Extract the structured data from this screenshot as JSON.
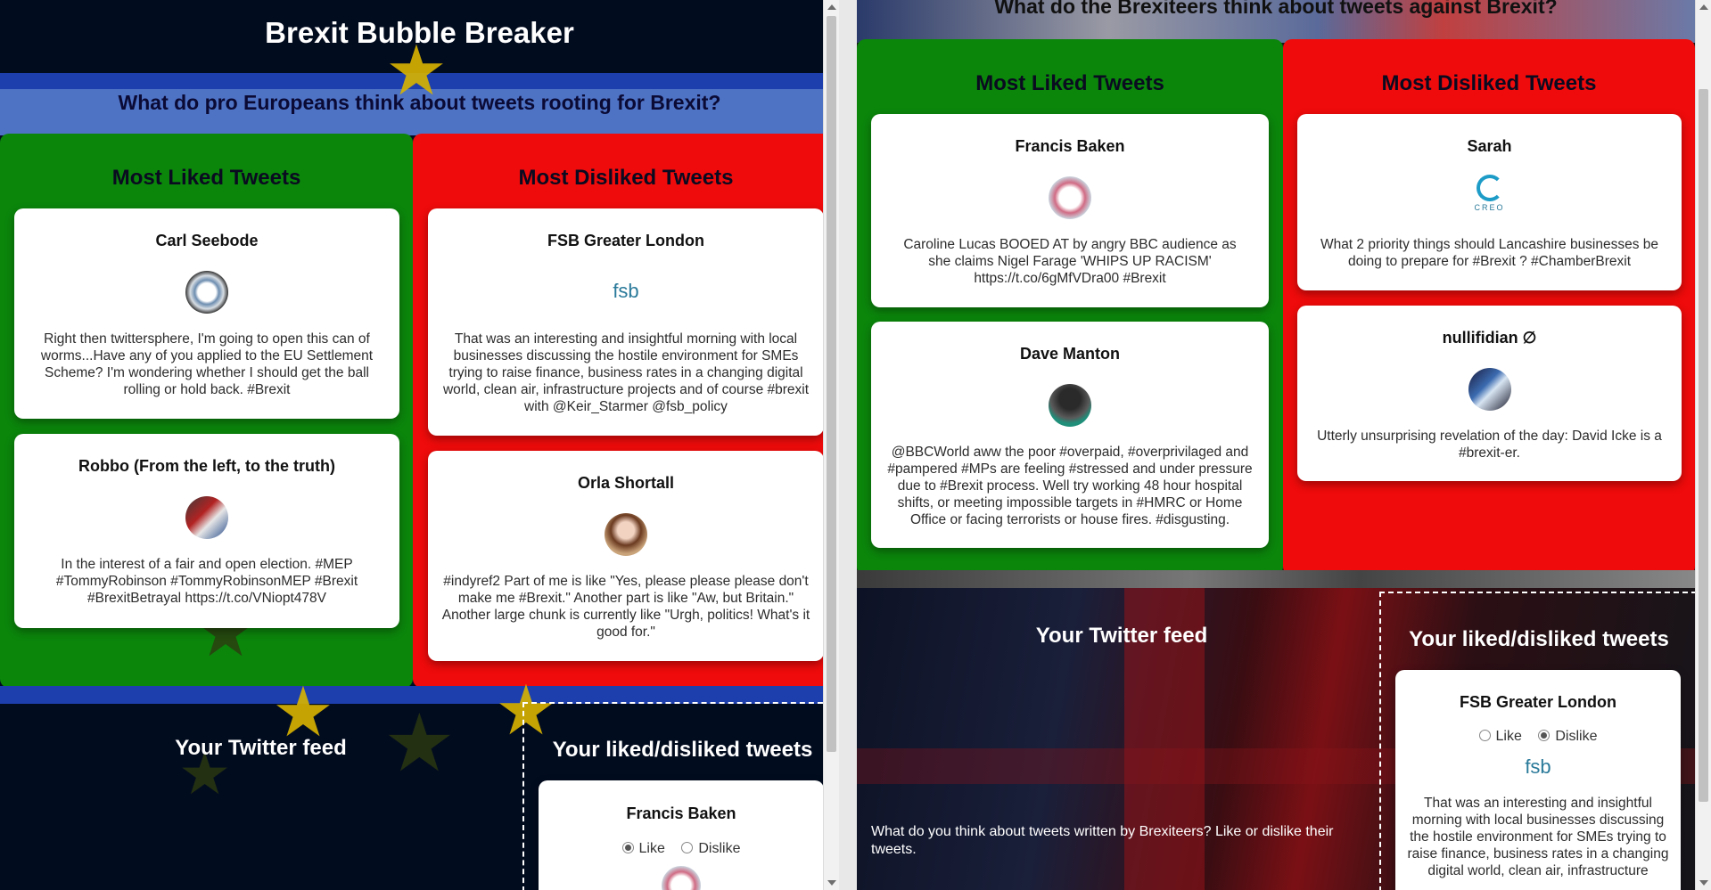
{
  "left": {
    "site_title": "Brexit Bubble Breaker",
    "question": "What do pro Europeans think about tweets rooting for Brexit?",
    "liked_title": "Most Liked Tweets",
    "disliked_title": "Most Disliked Tweets",
    "liked": [
      {
        "name": "Carl Seebode",
        "text": "Right then twittersphere, I'm going to open this can of worms...Have any of you applied to the EU Settlement Scheme? I'm wondering whether I should get the ball rolling or hold back. #Brexit"
      },
      {
        "name": "Robbo (From the left, to the truth)",
        "text": "In the interest of a fair and open election. #MEP #TommyRobinson #TommyRobinsonMEP #Brexit #BrexitBetrayal https://t.co/VNiopt478V"
      }
    ],
    "disliked": [
      {
        "name": "FSB Greater London",
        "logo": "fsb",
        "text": "That was an interesting and insightful morning with local businesses discussing the hostile environment for SMEs trying to raise finance, business rates in a changing digital world, clean air, infrastructure projects and of course #brexit with @Keir_Starmer @fsb_policy"
      },
      {
        "name": "Orla Shortall",
        "text": "#indyref2 Part of me is like \"Yes, please please please don't make me #Brexit.\" Another part is like \"Aw, but Britain.\" Another large chunk is currently like \"Urgh, politics! What's it good for.\""
      }
    ],
    "feed_title": "Your Twitter feed",
    "votes_title": "Your liked/disliked tweets",
    "vote_card": {
      "name": "Francis Baken",
      "like_label": "Like",
      "dislike_label": "Dislike",
      "selected": "Like"
    }
  },
  "right": {
    "question": "What do the Brexiteers think about tweets against Brexit?",
    "liked_title": "Most Liked Tweets",
    "disliked_title": "Most Disliked Tweets",
    "liked": [
      {
        "name": "Francis Baken",
        "text": "Caroline Lucas BOOED AT by angry BBC audience as she claims Nigel Farage 'WHIPS UP RACISM' https://t.co/6gMfVDra00 #Brexit"
      },
      {
        "name": "Dave Manton",
        "text": "@BBCWorld aww the poor #overpaid, #overprivilaged and #pampered #MPs are feeling #stressed and under pressure due to #Brexit process. Well try working 48 hour hospital shifts, or meeting impossible targets in #HMRC or Home Office or facing terrorists or house fires. #disgusting."
      }
    ],
    "disliked": [
      {
        "name": "Sarah",
        "logo": "CREO",
        "text": "What 2 priority things should Lancashire businesses be doing to prepare for #Brexit ? #ChamberBrexit"
      },
      {
        "name": "nullifidian ∅",
        "text": "Utterly unsurprising revelation of the day: David Icke is a #brexit-er."
      }
    ],
    "feed_title": "Your Twitter feed",
    "feed_desc": "What do you think about tweets written by Brexiteers? Like or dislike their tweets.",
    "votes_title": "Your liked/disliked tweets",
    "vote_card": {
      "name": "FSB Greater London",
      "logo": "fsb",
      "like_label": "Like",
      "dislike_label": "Dislike",
      "selected": "Dislike",
      "text": "That was an interesting and insightful morning with local businesses discussing the hostile environment for SMEs trying to raise finance, business rates in a changing digital world, clean air, infrastructure"
    }
  },
  "colors": {
    "liked_green": "#0b860b",
    "disliked_red": "#ef0b0b",
    "eu_blue": "#1d3fae",
    "eu_star": "#d9b400"
  }
}
